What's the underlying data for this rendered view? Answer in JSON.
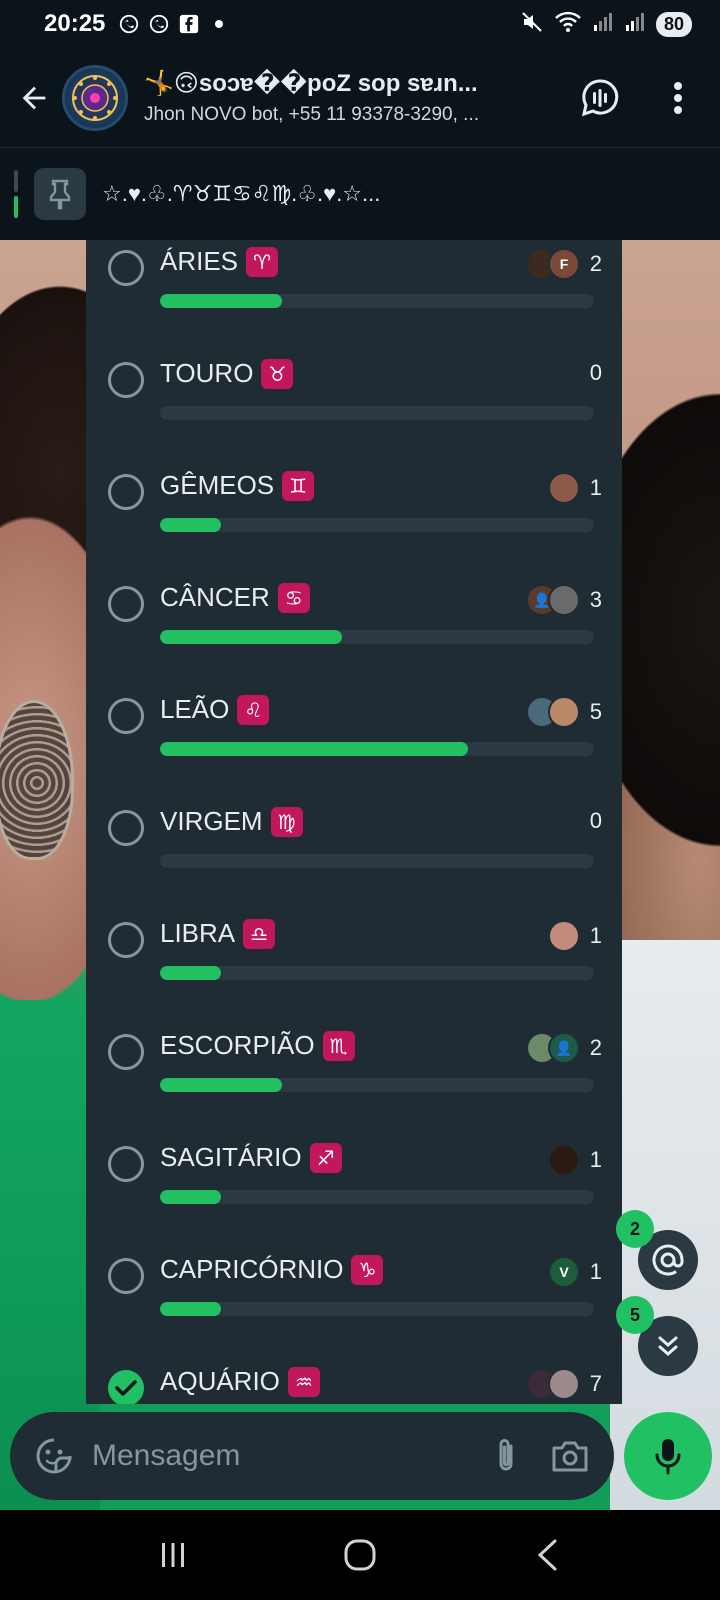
{
  "status_bar": {
    "time": "20:25",
    "battery": "80",
    "left_icons": [
      "whatsapp-icon",
      "whatsapp-icon",
      "facebook-icon",
      "dot-icon"
    ],
    "right_icons": [
      "mute-icon",
      "wifi-icon",
      "signal-icon",
      "signal-icon"
    ]
  },
  "header": {
    "group_name": "🤸🙃soɔɐ��poZ sop sɐɹn...",
    "subtitle": "Jhon NOVO bot, +55 11 93378-3290, ...",
    "actions": [
      "poll-voice-chat-icon",
      "more-options-icon"
    ]
  },
  "pinned": {
    "text": "☆.♥.♧.♈♉♊♋♌♍.♧.♥.☆..."
  },
  "poll": {
    "options": [
      {
        "label": "ÁRIES",
        "sign": "♈",
        "count": "2",
        "fraction": 0.28,
        "checked": false,
        "voters": [
          {
            "initial": "",
            "color": "#3a2a22"
          },
          {
            "initial": "F",
            "color": "#7a4a36"
          }
        ]
      },
      {
        "label": "TOURO",
        "sign": "♉",
        "count": "0",
        "fraction": 0.0,
        "checked": false,
        "voters": []
      },
      {
        "label": "GÊMEOS",
        "sign": "♊",
        "count": "1",
        "fraction": 0.14,
        "checked": false,
        "voters": [
          {
            "initial": "",
            "color": "#8c5a48"
          }
        ]
      },
      {
        "label": "CÂNCER",
        "sign": "♋",
        "count": "3",
        "fraction": 0.42,
        "checked": false,
        "voters": [
          {
            "initial": "👤",
            "color": "#5a3a2a"
          },
          {
            "initial": "",
            "color": "#6a6a6a"
          }
        ]
      },
      {
        "label": "LEÃO",
        "sign": "♌",
        "count": "5",
        "fraction": 0.71,
        "checked": false,
        "voters": [
          {
            "initial": "",
            "color": "#4a6a7a"
          },
          {
            "initial": "",
            "color": "#b88a6a"
          }
        ]
      },
      {
        "label": "VIRGEM",
        "sign": "♍",
        "count": "0",
        "fraction": 0.0,
        "checked": false,
        "voters": []
      },
      {
        "label": "LIBRA",
        "sign": "♎",
        "count": "1",
        "fraction": 0.14,
        "checked": false,
        "voters": [
          {
            "initial": "",
            "color": "#c28a7a"
          }
        ]
      },
      {
        "label": "ESCORPIÃO",
        "sign": "♏",
        "count": "2",
        "fraction": 0.28,
        "checked": false,
        "voters": [
          {
            "initial": "",
            "color": "#6a8a6a"
          },
          {
            "initial": "👤",
            "color": "#1f5a4a"
          }
        ]
      },
      {
        "label": "SAGITÁRIO",
        "sign": "♐",
        "count": "1",
        "fraction": 0.14,
        "checked": false,
        "voters": [
          {
            "initial": "",
            "color": "#2a1a14"
          }
        ]
      },
      {
        "label": "CAPRICÓRNIO",
        "sign": "♑",
        "count": "1",
        "fraction": 0.14,
        "checked": false,
        "voters": [
          {
            "initial": "V",
            "color": "#1e5c3e"
          }
        ]
      },
      {
        "label": "AQUÁRIO",
        "sign": "♒",
        "count": "7",
        "fraction": 1.0,
        "checked": true,
        "voters": [
          {
            "initial": "",
            "color": "#3a2a3a"
          },
          {
            "initial": "",
            "color": "#9a8a8a"
          }
        ]
      }
    ]
  },
  "fabs": {
    "mentions_badge": "2",
    "scroll_down_badge": "5"
  },
  "input": {
    "placeholder": "Mensagem"
  },
  "colors": {
    "accent": "#21c063",
    "panel": "#1f2c33",
    "background": "#0b141a",
    "zodiac_badge": "#c2185b"
  }
}
